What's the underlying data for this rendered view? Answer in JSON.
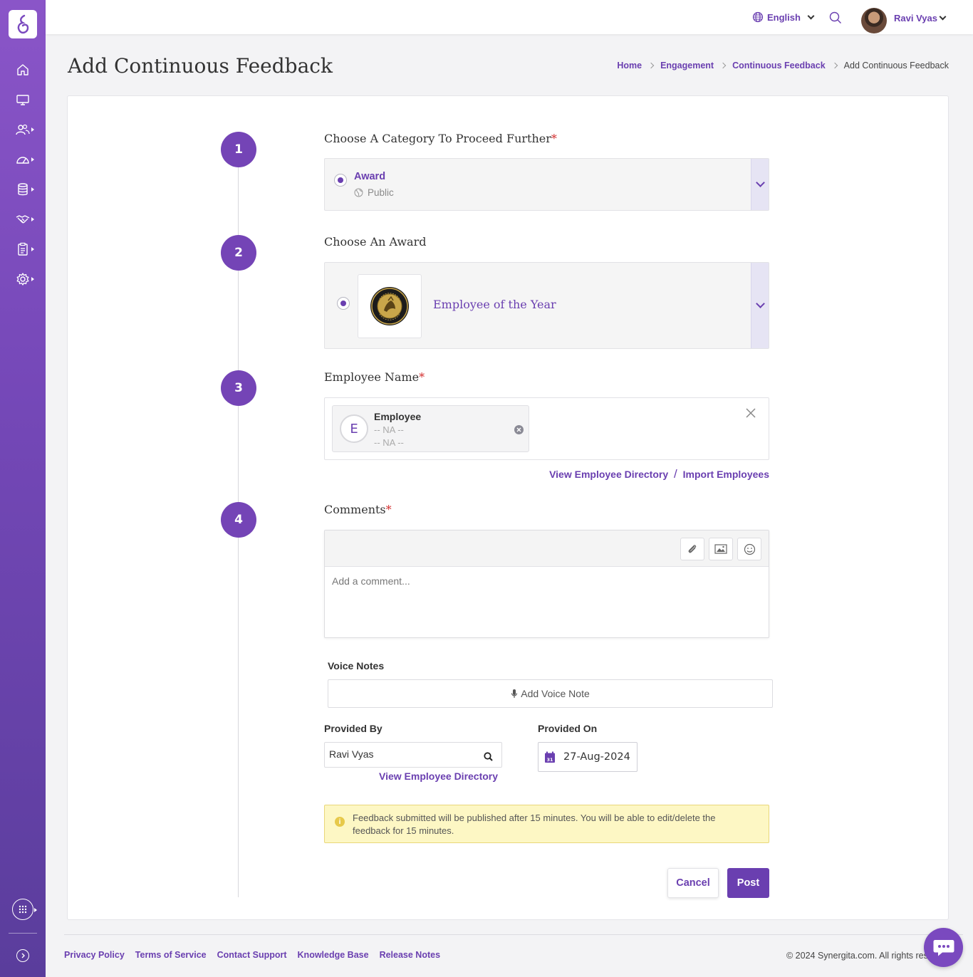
{
  "topbar": {
    "language": "English",
    "user_name": "Ravi Vyas"
  },
  "page": {
    "title": "Add Continuous Feedback"
  },
  "breadcrumb": [
    {
      "label": "Home"
    },
    {
      "label": "Engagement"
    },
    {
      "label": "Continuous Feedback"
    },
    {
      "label": "Add Continuous Feedback"
    }
  ],
  "steps": [
    {
      "number": "1",
      "title": "Choose A Category To Proceed Further",
      "required": "*"
    },
    {
      "number": "2",
      "title": "Choose An Award"
    },
    {
      "number": "3",
      "title": "Employee Name",
      "required": "*"
    },
    {
      "number": "4",
      "title": "Comments",
      "required": "*"
    }
  ],
  "category": {
    "selected": "Award",
    "visibility": "Public"
  },
  "award": {
    "selected": "Employee of the Year"
  },
  "employee": {
    "initial": "E",
    "name": "Employee",
    "line1": "-- NA --",
    "line2": "-- NA --",
    "view_directory": "View Employee Directory",
    "separator": "/",
    "import": "Import Employees"
  },
  "comments": {
    "placeholder": "Add a comment..."
  },
  "voice_notes": {
    "label": "Voice Notes",
    "button": "Add Voice Note"
  },
  "provided_by": {
    "label": "Provided By",
    "value": "Ravi Vyas",
    "view_directory": "View Employee Directory"
  },
  "provided_on": {
    "label": "Provided On",
    "value": "27-Aug-2024",
    "calendar_day": "31"
  },
  "notice": {
    "text": "Feedback submitted will be published after 15 minutes. You will be able to edit/delete the feedback for 15 minutes."
  },
  "actions": {
    "cancel": "Cancel",
    "post": "Post"
  },
  "footer": {
    "links": [
      "Privacy Policy",
      "Terms of Service",
      "Contact Support",
      "Knowledge Base",
      "Release Notes"
    ],
    "copyright": "© 2024 Synergita.com. All rights res"
  },
  "colors": {
    "brand": "#6a3fb0",
    "sidebar_top": "#8a55c8",
    "sidebar_bottom": "#5a3d9c",
    "notice_bg": "#fdf7c4",
    "required": "#d32f2f"
  },
  "icons": [
    "home-icon",
    "monitor-icon",
    "people-icon",
    "dashboard-icon",
    "database-icon",
    "handshake-icon",
    "clipboard-icon",
    "settings-icon",
    "apps-grid-icon",
    "expand-icon",
    "globe-icon",
    "search-icon",
    "paperclip-icon",
    "image-icon",
    "emoji-icon",
    "microphone-icon",
    "calendar-icon",
    "info-icon",
    "close-icon",
    "chat-icon"
  ]
}
